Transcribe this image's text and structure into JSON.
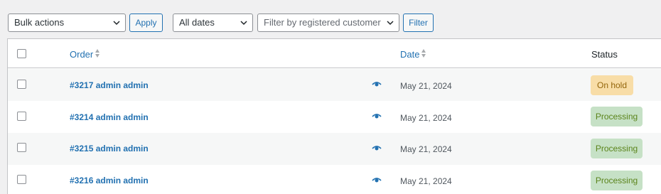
{
  "toolbar": {
    "bulk_actions": "Bulk actions",
    "apply": "Apply",
    "date_filter": "All dates",
    "customer_placeholder": "Filter by registered customer",
    "filter": "Filter"
  },
  "table": {
    "columns": {
      "order": "Order",
      "date": "Date",
      "status": "Status"
    },
    "rows": [
      {
        "order": "#3217 admin admin",
        "date": "May 21, 2024",
        "status": "On hold"
      },
      {
        "order": "#3214 admin admin",
        "date": "May 21, 2024",
        "status": "Processing"
      },
      {
        "order": "#3215 admin admin",
        "date": "May 21, 2024",
        "status": "Processing"
      },
      {
        "order": "#3216 admin admin",
        "date": "May 21, 2024",
        "status": "Processing"
      }
    ]
  },
  "colors": {
    "link": "#2271b1",
    "on_hold_bg": "#f8dda7",
    "on_hold_text": "#94660c",
    "processing_bg": "#c6e1c6",
    "processing_text": "#5b841b"
  },
  "icons": [
    "chevron-down-icon",
    "sort-icon",
    "eye-icon",
    "checkbox"
  ]
}
